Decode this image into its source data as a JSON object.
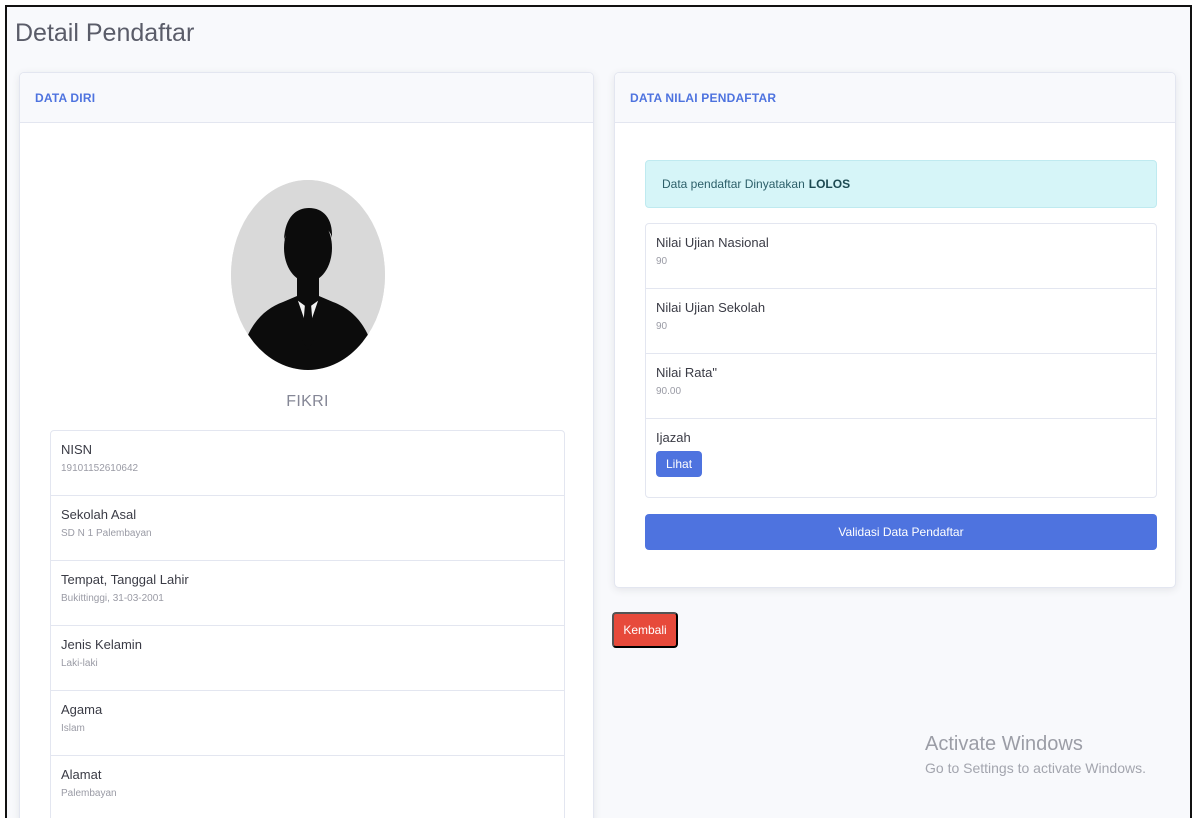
{
  "page": {
    "title": "Detail Pendaftar"
  },
  "left_card": {
    "header": "DATA DIRI",
    "name": "FIKRI",
    "items": [
      {
        "label": "NISN",
        "value": "19101152610642"
      },
      {
        "label": "Sekolah Asal",
        "value": "SD N 1 Palembayan"
      },
      {
        "label": "Tempat, Tanggal Lahir",
        "value": "Bukittinggi, 31-03-2001"
      },
      {
        "label": "Jenis Kelamin",
        "value": "Laki-laki"
      },
      {
        "label": "Agama",
        "value": "Islam"
      },
      {
        "label": "Alamat",
        "value": "Palembayan"
      }
    ]
  },
  "right_card": {
    "header": "DATA NILAI PENDAFTAR",
    "alert_text": "Data pendaftar Dinyatakan",
    "alert_status": "LOLOS",
    "items": [
      {
        "label": "Nilai Ujian Nasional",
        "value": "90"
      },
      {
        "label": "Nilai Ujian Sekolah",
        "value": "90"
      },
      {
        "label": "Nilai Rata\"",
        "value": "90.00"
      }
    ],
    "ijazah_label": "Ijazah",
    "lihat_button": "Lihat",
    "validate_button": "Validasi Data Pendaftar"
  },
  "back_button": "Kembali",
  "watermark": {
    "line1": "Activate Windows",
    "line2": "Go to Settings to activate Windows."
  },
  "colors": {
    "primary": "#4e73df",
    "danger": "#e74a3b",
    "info_bg": "#d6f5f8"
  }
}
